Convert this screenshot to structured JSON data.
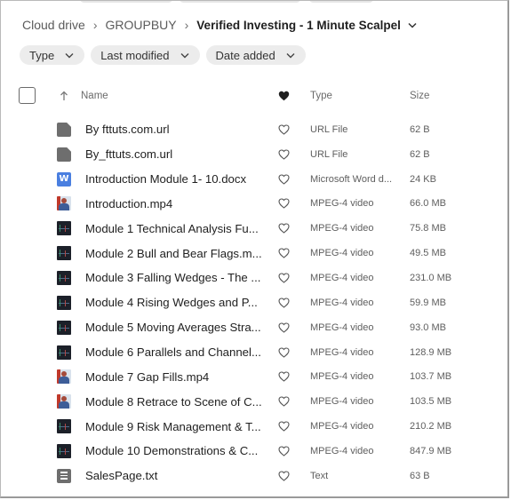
{
  "breadcrumb": {
    "items": [
      "Cloud drive",
      "GROUPBUY"
    ],
    "current": "Verified Investing - 1 Minute Scalpel"
  },
  "filters": [
    {
      "label": "Type"
    },
    {
      "label": "Last modified"
    },
    {
      "label": "Date added"
    }
  ],
  "columns": {
    "name": "Name",
    "type": "Type",
    "size": "Size"
  },
  "files": [
    {
      "name": "By fttuts.com.url",
      "type": "URL File",
      "size": "62 B",
      "icon": "generic-file-icon"
    },
    {
      "name": "By_fttuts.com.url",
      "type": "URL File",
      "size": "62 B",
      "icon": "generic-file-icon"
    },
    {
      "name": "Introduction Module 1- 10.docx",
      "type": "Microsoft Word d...",
      "size": "24 KB",
      "icon": "word-doc-icon",
      "glyph": "W"
    },
    {
      "name": "Introduction.mp4",
      "type": "MPEG-4 video",
      "size": "66.0 MB",
      "icon": "video-thumbnail-icon"
    },
    {
      "name": "Module 1 Technical Analysis Fu...",
      "type": "MPEG-4 video",
      "size": "75.8 MB",
      "icon": "video-chart-thumbnail-icon"
    },
    {
      "name": "Module 2 Bull and Bear Flags.m...",
      "type": "MPEG-4 video",
      "size": "49.5 MB",
      "icon": "video-chart-thumbnail-icon"
    },
    {
      "name": "Module 3 Falling Wedges - The ...",
      "type": "MPEG-4 video",
      "size": "231.0 MB",
      "icon": "video-chart-thumbnail-icon"
    },
    {
      "name": "Module 4 Rising Wedges and P...",
      "type": "MPEG-4 video",
      "size": "59.9 MB",
      "icon": "video-chart-thumbnail-icon"
    },
    {
      "name": "Module 5 Moving Averages Stra...",
      "type": "MPEG-4 video",
      "size": "93.0 MB",
      "icon": "video-chart-thumbnail-icon"
    },
    {
      "name": "Module 6 Parallels and Channel...",
      "type": "MPEG-4 video",
      "size": "128.9 MB",
      "icon": "video-chart-thumbnail-icon"
    },
    {
      "name": "Module 7 Gap Fills.mp4",
      "type": "MPEG-4 video",
      "size": "103.7 MB",
      "icon": "video-thumbnail-icon"
    },
    {
      "name": "Module 8 Retrace to Scene of C...",
      "type": "MPEG-4 video",
      "size": "103.5 MB",
      "icon": "video-thumbnail-icon"
    },
    {
      "name": "Module 9 Risk Management & T...",
      "type": "MPEG-4 video",
      "size": "210.2 MB",
      "icon": "video-chart-thumbnail-icon"
    },
    {
      "name": "Module 10 Demonstrations & C...",
      "type": "MPEG-4 video",
      "size": "847.9 MB",
      "icon": "video-chart-thumbnail-icon"
    },
    {
      "name": "SalesPage.txt",
      "type": "Text",
      "size": "63 B",
      "icon": "text-file-icon"
    }
  ]
}
